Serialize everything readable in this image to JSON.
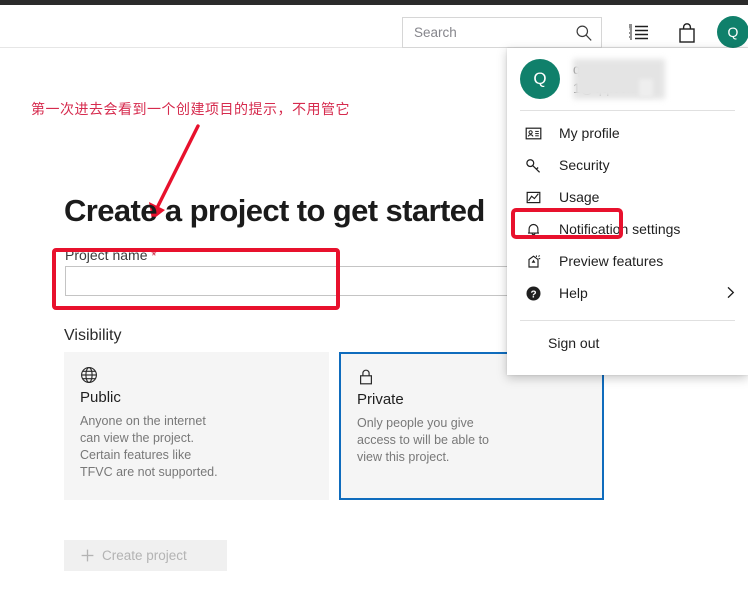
{
  "header": {
    "search": {
      "placeholder": "Search",
      "value": "",
      "icon": "search-icon"
    },
    "icons": [
      {
        "name": "backlog-icon",
        "label": "Backlog"
      },
      {
        "name": "shopping-bag-icon",
        "label": "Marketplace"
      }
    ],
    "avatar": {
      "initial": "Q",
      "color": "#10806b"
    }
  },
  "annotation": {
    "note_cn": "第一次进去会看到一个创建项目的提示，不用管它",
    "note_color": "#d62b4e",
    "highlight_color": "#e8112d",
    "arrow_color": "#e8112d"
  },
  "main": {
    "title": "Create a project to get started",
    "project_name": {
      "label": "Project name",
      "required_marker": "*",
      "value": "",
      "placeholder": ""
    },
    "visibility": {
      "section_label": "Visibility",
      "options": [
        {
          "key": "public",
          "icon": "globe-icon",
          "title": "Public",
          "description": "Anyone on the internet can view the project. Certain features like TFVC are not supported.",
          "selected": false
        },
        {
          "key": "private",
          "icon": "lock-icon",
          "title": "Private",
          "description": "Only people you give access to will be able to view this project.",
          "selected": true,
          "selected_border_color": "#0f6cbd"
        }
      ]
    },
    "create_button": {
      "label": "Create project",
      "icon": "plus-icon",
      "disabled": true
    }
  },
  "dropdown": {
    "profile": {
      "avatar_initial": "Q",
      "avatar_color": "#10806b",
      "name": "qq.com",
      "email": "1@qq.com",
      "redacted": true
    },
    "items": [
      {
        "icon": "contact-card-icon",
        "label": "My profile",
        "has_submenu": false,
        "highlighted": false
      },
      {
        "icon": "key-icon",
        "label": "Security",
        "has_submenu": false,
        "highlighted": true
      },
      {
        "icon": "usage-chart-icon",
        "label": "Usage",
        "has_submenu": false,
        "highlighted": false
      },
      {
        "icon": "bell-icon",
        "label": "Notification settings",
        "has_submenu": false,
        "highlighted": false
      },
      {
        "icon": "preview-features-icon",
        "label": "Preview features",
        "has_submenu": false,
        "highlighted": false
      },
      {
        "icon": "help-circle-icon",
        "label": "Help",
        "has_submenu": true,
        "highlighted": false
      }
    ],
    "sign_out": {
      "label": "Sign out"
    }
  }
}
